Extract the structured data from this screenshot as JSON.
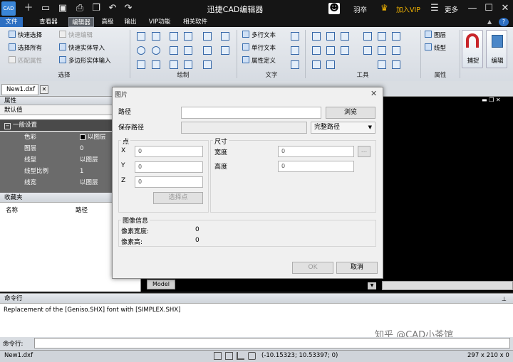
{
  "app": {
    "title": "迅捷CAD编辑器",
    "logo_text": "CAD"
  },
  "titlebar": {
    "user": "羽卒",
    "vip": "加入VIP",
    "more": "更多"
  },
  "menu": [
    "文件",
    "查看器",
    "编辑器",
    "高级",
    "输出",
    "VIP功能",
    "相关软件"
  ],
  "ribbon": {
    "select": {
      "items": [
        "快速选择",
        "选择所有",
        "匹配属性",
        "快速编辑",
        "快速实体导入",
        "多边形实体输入"
      ],
      "label": "选择"
    },
    "draw_label": "绘制",
    "text": {
      "items": [
        "多行文本",
        "单行文本",
        "属性定义"
      ],
      "label": "文字"
    },
    "tools_label": "工具",
    "props": {
      "items": [
        "图层",
        "线型"
      ],
      "label": "属性"
    },
    "snap": "捕捉",
    "edit": "编辑"
  },
  "doc_tab": "New1.dxf",
  "properties": {
    "header": "属性",
    "default": "默认值",
    "section": "一般设置",
    "rows": [
      {
        "name": "色彩",
        "value": "以图层"
      },
      {
        "name": "图层",
        "value": "0"
      },
      {
        "name": "线型",
        "value": "以图层"
      },
      {
        "name": "线型比例",
        "value": "1"
      },
      {
        "name": "线宽",
        "value": "以图层"
      }
    ]
  },
  "favorites": {
    "header": "收藏夹",
    "col_name": "名称",
    "col_path": "路径"
  },
  "model_tab": "Model",
  "command": {
    "header": "命令行",
    "log": "Replacement of the [Geniso.SHX] font with [SIMPLEX.SHX]",
    "prompt": "命令行:"
  },
  "watermark": "知乎 @CAD小茶馆",
  "status": {
    "file": "New1.dxf",
    "coords": "(-10.15323; 10.53397; 0)",
    "size": "297 x 210 x 0"
  },
  "dialog": {
    "title": "图片",
    "path_label": "路径",
    "save_path_label": "保存路径",
    "browse": "浏览",
    "path_mode": "完整路径",
    "point": {
      "title": "点",
      "x": "X",
      "y": "Y",
      "z": "Z",
      "x_val": "0",
      "y_val": "0",
      "z_val": "0",
      "pick": "选择点"
    },
    "size": {
      "title": "尺寸",
      "width_label": "宽度",
      "height_label": "高度",
      "width_val": "0",
      "height_val": "0",
      "more": "..."
    },
    "info": {
      "title": "图像信息",
      "pw_label": "像素宽度:",
      "ph_label": "像素高:",
      "pw": "0",
      "ph": "0"
    },
    "ok": "OK",
    "cancel": "取消"
  }
}
